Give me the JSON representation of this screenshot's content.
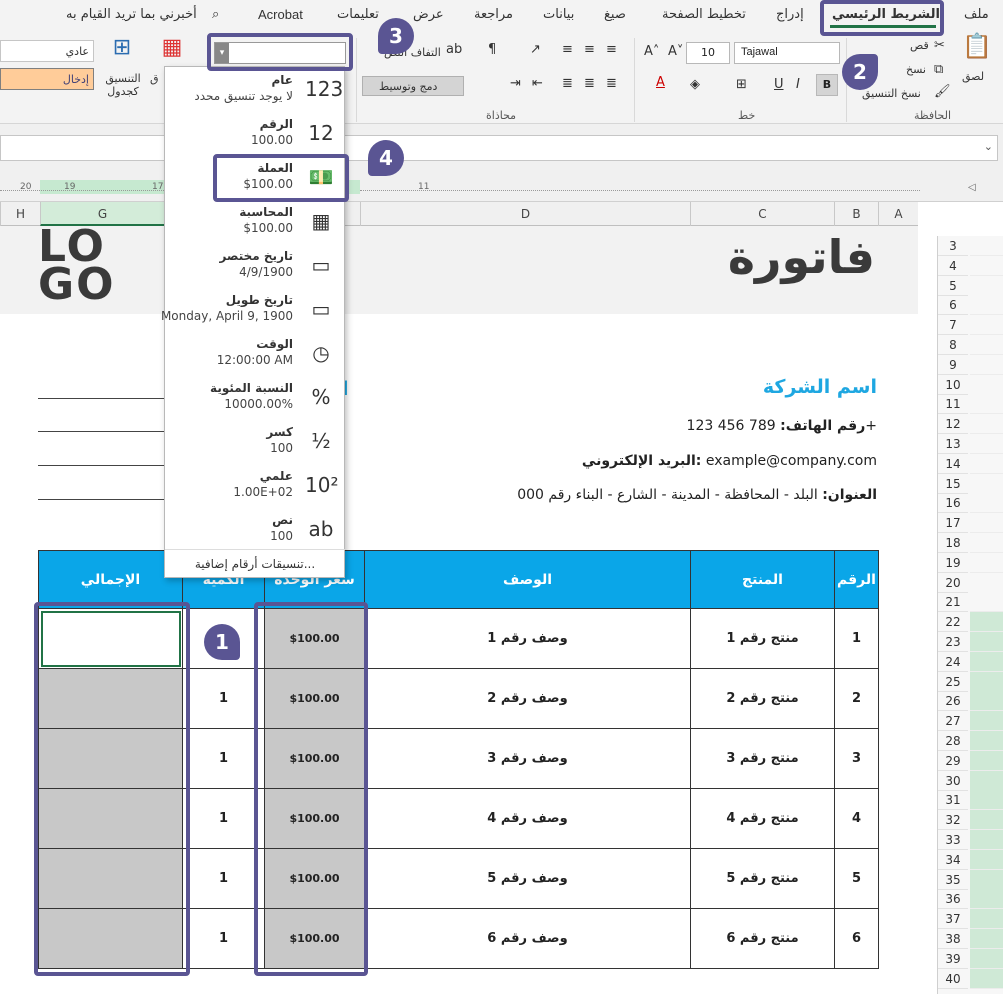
{
  "menu": {
    "file": "ملف",
    "home": "الشريط الرئيسي",
    "insert": "إدراج",
    "page_layout": "تخطيط الصفحة",
    "formulas": "صيغ",
    "data": "بيانات",
    "review": "مراجعة",
    "view": "عرض",
    "help": "تعليمات",
    "acrobat": "Acrobat",
    "tell_me": "أخبرني بما تريد القيام به"
  },
  "ribbon": {
    "clipboard": {
      "label": "الحافظة",
      "paste": "لصق",
      "cut": "قص",
      "copy": "نسخ",
      "format_painter": "نسخ التنسيق"
    },
    "font": {
      "label": "خط",
      "name": "Tajawal",
      "size": "10",
      "bold": "B",
      "italic": "I",
      "underline": "U"
    },
    "alignment": {
      "label": "محاذاة",
      "wrap": "التفاف النص",
      "merge": "دمج وتوسيط"
    },
    "number_format_value": "",
    "styles": {
      "normal": "عادي",
      "input": "إدخال",
      "format_as_table": "التنسيق كجدول"
    }
  },
  "columns": [
    "A",
    "B",
    "C",
    "D",
    "G",
    "H"
  ],
  "ruler_ticks": [
    "11",
    "17",
    "19",
    "20"
  ],
  "rows": [
    "3",
    "4",
    "5",
    "6",
    "7",
    "8",
    "9",
    "10",
    "11",
    "12",
    "13",
    "14",
    "15",
    "16",
    "17",
    "18",
    "19",
    "20",
    "21",
    "22",
    "23",
    "24",
    "25",
    "26",
    "27",
    "28",
    "29",
    "30",
    "31",
    "32",
    "33",
    "34",
    "35",
    "36",
    "37",
    "38",
    "39",
    "40"
  ],
  "invoice": {
    "title": "فاتورة",
    "logo_top": "LO",
    "logo_bottom": "GO",
    "company": "اسم الشركة",
    "phone_label": "رقم الهاتف:",
    "phone": "789 456 123+",
    "email_label": "البريد الإلكتروني:",
    "email": "example@company.com",
    "address_label": "العنوان:",
    "address": "البلد - المحافظة - المدينة - الشارع - البناء رقم 000",
    "partial_right_header": "ا"
  },
  "table": {
    "headers": [
      "الرقم",
      "المنتج",
      "الوصف",
      "سعر الوحدة",
      "الكمية",
      "الإجمالي"
    ],
    "rows": [
      {
        "num": "1",
        "product": "منتج رقم 1",
        "desc": "وصف رقم 1",
        "price": "$100.00",
        "qty": ""
      },
      {
        "num": "2",
        "product": "منتج رقم 2",
        "desc": "وصف رقم 2",
        "price": "$100.00",
        "qty": "1"
      },
      {
        "num": "3",
        "product": "منتج رقم 3",
        "desc": "وصف رقم 3",
        "price": "$100.00",
        "qty": "1"
      },
      {
        "num": "4",
        "product": "منتج رقم 4",
        "desc": "وصف رقم 4",
        "price": "$100.00",
        "qty": "1"
      },
      {
        "num": "5",
        "product": "منتج رقم 5",
        "desc": "وصف رقم 5",
        "price": "$100.00",
        "qty": "1"
      },
      {
        "num": "6",
        "product": "منتج رقم 6",
        "desc": "وصف رقم 6",
        "price": "$100.00",
        "qty": "1"
      }
    ]
  },
  "formats": [
    {
      "name": "عام",
      "example": "لا يوجد تنسيق محدد",
      "icon": "123"
    },
    {
      "name": "الرقم",
      "example": "100.00",
      "icon": "12"
    },
    {
      "name": "العملة",
      "example": "$100.00",
      "icon": "💵"
    },
    {
      "name": "المحاسبة",
      "example": "$100.00",
      "icon": "▦"
    },
    {
      "name": "تاريخ مختصر",
      "example": "4/9/1900",
      "icon": "▭"
    },
    {
      "name": "تاريخ طويل",
      "example": "Monday, April 9, 1900",
      "icon": "▭"
    },
    {
      "name": "الوقت",
      "example": "12:00:00 AM",
      "icon": "◷"
    },
    {
      "name": "النسبة المئوية",
      "example": "10000.00%",
      "icon": "%"
    },
    {
      "name": "كسر",
      "example": "100",
      "icon": "½"
    },
    {
      "name": "علمي",
      "example": "1.00E+02",
      "icon": "10²"
    },
    {
      "name": "نص",
      "example": "100",
      "icon": "ab"
    }
  ],
  "more_formats": "تنسيقات أرقام إضافية...",
  "badges": [
    "1",
    "2",
    "3",
    "4"
  ],
  "colors": {
    "accent": "#5a5593",
    "header_blue": "#0aa6e8",
    "company_blue": "#1ea7e1",
    "grey_cell": "#c8c8c8"
  }
}
